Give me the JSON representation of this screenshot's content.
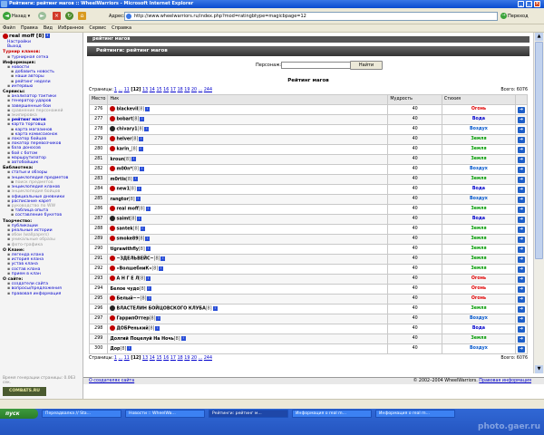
{
  "window_title": "Рейтинги: рейтинг магов :: WheelWarriors - Microsoft Internet Explorer",
  "toolbar": {
    "back": "Назад",
    "address_label": "Адрес:",
    "url": "http://www.wheelwarriors.ru/index.php?mod=ratingbtype=magicbpage=12",
    "go": "Переход"
  },
  "menu": [
    "Файл",
    "Правка",
    "Вид",
    "Избранное",
    "Сервис",
    "Справка"
  ],
  "sidebar": {
    "user": "real moff [8]",
    "user_links": [
      "Настройки",
      "Выход"
    ],
    "sections": [
      {
        "title": "Турнир кланов:",
        "red": true,
        "items": [
          {
            "t": "турнирная сетка",
            "lvl": 1
          }
        ]
      },
      {
        "title": "Информация:",
        "items": [
          {
            "t": "новости",
            "lvl": 1
          },
          {
            "t": "добавить новость",
            "lvl": 2
          },
          {
            "t": "наши авторы",
            "lvl": 2
          },
          {
            "t": "рейтинг недели",
            "lvl": 2
          },
          {
            "t": "интервью",
            "lvl": 1
          }
        ]
      },
      {
        "title": "Сервисы:",
        "items": [
          {
            "t": "анализатор тактики",
            "lvl": 1
          },
          {
            "t": "генератор ударов",
            "lvl": 1
          },
          {
            "t": "завершенные бои",
            "lvl": 1
          },
          {
            "t": "сравнение персонажей",
            "lvl": 1,
            "gray": true
          },
          {
            "t": "экипировка",
            "lvl": 1,
            "gray": true
          },
          {
            "t": "рейтинг магов",
            "lvl": 1,
            "bold": true
          },
          {
            "t": "карта торговца",
            "lvl": 1
          },
          {
            "t": "карта магазинов",
            "lvl": 2
          },
          {
            "t": "карта комиссионок",
            "lvl": 2
          },
          {
            "t": "локатор бойцов",
            "lvl": 1
          },
          {
            "t": "локатор перевозчиков",
            "lvl": 1
          },
          {
            "t": "база доносов",
            "lvl": 1
          },
          {
            "t": "бой с ботом",
            "lvl": 1
          },
          {
            "t": "маршрутизатор",
            "lvl": 1
          },
          {
            "t": "автобойщик",
            "lvl": 1
          }
        ]
      },
      {
        "title": "Библиотека:",
        "items": [
          {
            "t": "статьи и обзоры",
            "lvl": 1
          },
          {
            "t": "энциклопедия предметов",
            "lvl": 1
          },
          {
            "t": "поиск предметов",
            "lvl": 2,
            "gray": true
          },
          {
            "t": "энциклопедия кланов",
            "lvl": 1
          },
          {
            "t": "энциклопедия бойцов",
            "lvl": 1,
            "gray": true
          },
          {
            "t": "официальные дневники",
            "lvl": 1
          },
          {
            "t": "расписание карет",
            "lvl": 1
          },
          {
            "t": "руководство по WW",
            "lvl": 1,
            "gray": true
          },
          {
            "t": "таблица опыта",
            "lvl": 2
          },
          {
            "t": "составление букетов",
            "lvl": 2
          }
        ]
      },
      {
        "title": "Творчество:",
        "items": [
          {
            "t": "публикации",
            "lvl": 1
          },
          {
            "t": "реальные истории",
            "lvl": 1
          },
          {
            "t": "обои (wallpapers)",
            "lvl": 1,
            "gray": true
          },
          {
            "t": "уникальные образы",
            "lvl": 1,
            "gray": true
          },
          {
            "t": "фото-графика",
            "lvl": 1,
            "gray": true
          }
        ]
      },
      {
        "title": "О Клане:",
        "items": [
          {
            "t": "легенда клана",
            "lvl": 1
          },
          {
            "t": "история клана",
            "lvl": 1
          },
          {
            "t": "устав клана",
            "lvl": 1
          },
          {
            "t": "состав клана",
            "lvl": 1
          },
          {
            "t": "прием в клан",
            "lvl": 1
          }
        ]
      },
      {
        "title": "О сайте:",
        "items": [
          {
            "t": "создатели сайта",
            "lvl": 1
          },
          {
            "t": "вопросы/предложения",
            "lvl": 1
          },
          {
            "t": "правовая информация",
            "lvl": 1
          }
        ]
      }
    ],
    "gen_time": "Время генерации страницы: 0.063 сек.",
    "logo": "COMBATS.RU"
  },
  "content": {
    "header1": "рейтинг магов",
    "header2": "Рейтинги: рейтинг магов",
    "search_label": "Персонаж:",
    "search_value": "",
    "find_button": "Найти",
    "table_title": "Рейтинг магов",
    "pages_label": "Страницы:",
    "pages": [
      "1",
      "...",
      "11",
      "[12]",
      "13",
      "14",
      "15",
      "16",
      "17",
      "18",
      "19",
      "20",
      "...",
      "244"
    ],
    "total": "Всего: 6076",
    "columns": [
      "Место",
      "Ник",
      "Мудрость",
      "Стихия",
      ""
    ],
    "rows": [
      {
        "place": "276",
        "nick": "blackevil",
        "lvl": "[8]",
        "wis": "40",
        "el": "Огонь",
        "clan": "#c00000"
      },
      {
        "place": "277",
        "nick": "bobart",
        "lvl": "[8]",
        "wis": "40",
        "el": "Вода",
        "clan": "#c00000"
      },
      {
        "place": "278",
        "nick": "chivary1",
        "lvl": "[8]",
        "wis": "40",
        "el": "Воздух",
        "clan": "#222222"
      },
      {
        "place": "279",
        "nick": "helver",
        "lvl": "[8]",
        "wis": "40",
        "el": "Земля",
        "clan": "#c00000"
      },
      {
        "place": "280",
        "nick": "karin_",
        "lvl": "[8]",
        "wis": "40",
        "el": "Земля",
        "clan": "#c00000"
      },
      {
        "place": "281",
        "nick": "kroun",
        "lvl": "[8]",
        "wis": "40",
        "el": "Земля",
        "clan": ""
      },
      {
        "place": "282",
        "nick": "m00n*",
        "lvl": "[8]",
        "wis": "40",
        "el": "Воздух",
        "clan": "#c00000"
      },
      {
        "place": "283",
        "nick": "m0rtis",
        "lvl": "[8]",
        "wis": "40",
        "el": "Земля",
        "clan": ""
      },
      {
        "place": "284",
        "nick": "new1",
        "lvl": "[8]",
        "wis": "40",
        "el": "Вода",
        "clan": "#c00000"
      },
      {
        "place": "285",
        "nick": "rangtor",
        "lvl": "[8]",
        "wis": "40",
        "el": "Воздух",
        "clan": ""
      },
      {
        "place": "286",
        "nick": "real moff",
        "lvl": "[8]",
        "wis": "40",
        "el": "Земля",
        "clan": "#c00000"
      },
      {
        "place": "287",
        "nick": "saimt",
        "lvl": "[8]",
        "wis": "40",
        "el": "Вода",
        "clan": "#222222"
      },
      {
        "place": "288",
        "nick": "santek",
        "lvl": "[8]",
        "wis": "40",
        "el": "Земля",
        "clan": "#c00000"
      },
      {
        "place": "289",
        "nick": "smoke89",
        "lvl": "[8]",
        "wis": "40",
        "el": "Земля",
        "clan": "#c00000"
      },
      {
        "place": "290",
        "nick": "tigrawithfly",
        "lvl": "[8]",
        "wis": "40",
        "el": "Земля",
        "clan": ""
      },
      {
        "place": "291",
        "nick": "~ЗДЕЛЬВЕЙС~",
        "lvl": "[8]",
        "wis": "40",
        "el": "Земля",
        "clan": "#c00000"
      },
      {
        "place": "292",
        "nick": "»ВолшебниК«",
        "lvl": "[8]",
        "wis": "40",
        "el": "Земля",
        "clan": "#c00000"
      },
      {
        "place": "293",
        "nick": "А Н Г Е Л",
        "lvl": "[8]",
        "wis": "40",
        "el": "Огонь",
        "clan": "#c00000"
      },
      {
        "place": "294",
        "nick": "Белое чудо",
        "lvl": "[8]",
        "wis": "40",
        "el": "Огонь",
        "clan": ""
      },
      {
        "place": "295",
        "nick": "Белый~~",
        "lvl": "[8]",
        "wis": "40",
        "el": "Огонь",
        "clan": "#c00000"
      },
      {
        "place": "296",
        "nick": "ВЛАСТЕЛИН БОЙЦОВСКОГО КЛУБА",
        "lvl": "[8]",
        "wis": "40",
        "el": "Земля",
        "clan": "#222222"
      },
      {
        "place": "297",
        "nick": "ГаррипОттер",
        "lvl": "[8]",
        "wis": "40",
        "el": "Воздух",
        "clan": "#c00000"
      },
      {
        "place": "298",
        "nick": "ДОБРенький",
        "lvl": "[8]",
        "wis": "40",
        "el": "Вода",
        "clan": "#c00000"
      },
      {
        "place": "299",
        "nick": "Долгий Поцелуй На Ночь",
        "lvl": "[8]",
        "wis": "40",
        "el": "Земля",
        "clan": ""
      },
      {
        "place": "300",
        "nick": "Дор",
        "lvl": "[8]",
        "wis": "40",
        "el": "Воздух",
        "clan": ""
      }
    ]
  },
  "element_colors": {
    "Огонь": "#e00000",
    "Вода": "#0000cc",
    "Воздух": "#0055cc",
    "Земля": "#009900"
  },
  "footer": {
    "left": "О создателях сайта",
    "right": "© 2002–2004 WheelWarriors.",
    "right_link": "Правовая информация"
  },
  "statusbar": {
    "text": ""
  },
  "taskbar": {
    "start": "пуск",
    "tasks": [
      "Переадвалка // Sta...",
      "Новости :: WheelWa...",
      "Рейтинги: рейтинг м...",
      "Информация о real m...",
      "Информация о real m..."
    ],
    "active": 2
  },
  "watermark": "photo.gaer.ru"
}
